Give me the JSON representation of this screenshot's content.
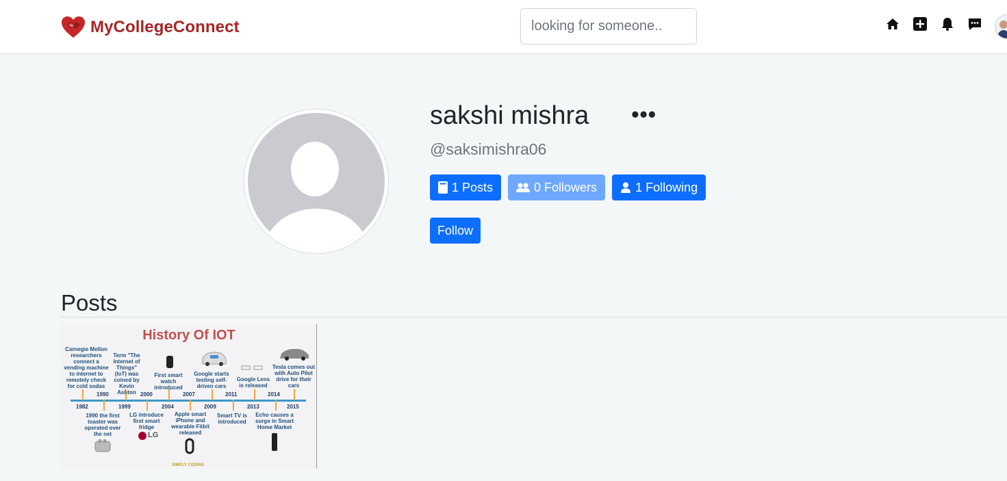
{
  "navbar": {
    "brand": "MyCollegeConnect",
    "search_placeholder": "looking for someone..",
    "icons": [
      "home-icon",
      "add-post-icon",
      "bell-icon",
      "messages-icon"
    ],
    "brand_color": "#a82424"
  },
  "profile": {
    "name": "sakshi mishra",
    "more": "•••",
    "handle": "@saksimishra06",
    "stats": {
      "posts": "1 Posts",
      "followers": "0 Followers",
      "following": "1 Following"
    },
    "follow_label": "Follow"
  },
  "posts": {
    "title": "Posts",
    "items": [
      {
        "image_title": "History Of IOT",
        "events_top": [
          "Carnegie Mellon researchers connect a vending machine to internet to remotely check for cold sodas",
          "Term \"The Internet of Things\" (IoT) was coined by Kevin Ashton",
          "First smart watch introduced",
          "Google starts testing self-driven cars",
          "Google Lens is released",
          "Tesla comes out with Auto Pilot drive for their cars"
        ],
        "events_bottom": [
          "1990 the first toaster was operated over the net",
          "LG introduce first smart fridge",
          "Apple smart iPhone and wearable Fitbit released",
          "Smart TV is introduced",
          "Echo causes a surge in Smart Home Market"
        ],
        "years_top": [
          "1990",
          "2000",
          "2007",
          "2011",
          "2014"
        ],
        "years_bottom": [
          "1982",
          "1999",
          "2004",
          "2009",
          "2013",
          "2015"
        ],
        "logo_text": "LG",
        "watermark": "SIMPLY CODING"
      }
    ]
  },
  "colors": {
    "primary": "#0d6efd",
    "primary_light": "#6ea8fe",
    "background": "#f4f7f8"
  }
}
